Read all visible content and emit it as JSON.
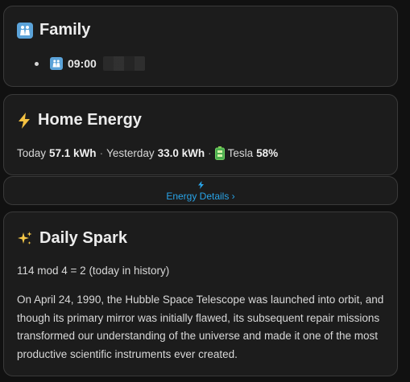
{
  "family": {
    "title": "Family",
    "icon": "family-icon",
    "items": [
      {
        "time": "09:00",
        "icon": "family-icon"
      }
    ]
  },
  "energy": {
    "title": "Home Energy",
    "icon": "lightning-icon",
    "today_label": "Today",
    "today_value": "57.1 kWh",
    "yesterday_label": "Yesterday",
    "yesterday_value": "33.0 kWh",
    "separator": "·",
    "tesla_label": "Tesla",
    "tesla_value": "58%",
    "battery_icon": "battery-icon"
  },
  "energy_details": {
    "label": "Energy Details ›",
    "icon": "lightning-icon",
    "accent": "#29a4e8"
  },
  "spark": {
    "title": "Daily Spark",
    "icon": "sparkles-icon",
    "subtitle": "114 mod 4 = 2 (today in history)",
    "body": "On April 24, 1990, the Hubble Space Telescope was launched into orbit, and though its primary mirror was initially flawed, its subsequent repair missions transformed our understanding of the universe and made it one of the most productive scientific instruments ever created."
  }
}
